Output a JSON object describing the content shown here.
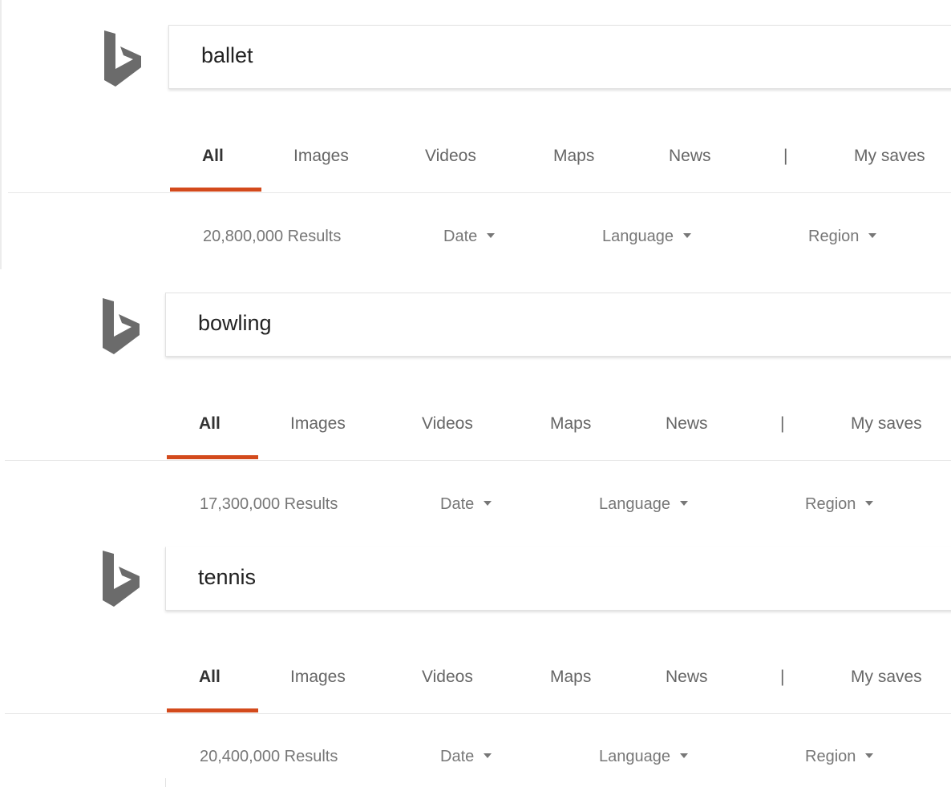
{
  "colors": {
    "accent": "#d34a1c",
    "logo": "#6b6b6b",
    "text": "#666666"
  },
  "logo_icon": "bing-b-icon",
  "nav": {
    "tabs": [
      {
        "label": "All",
        "active": true
      },
      {
        "label": "Images",
        "active": false
      },
      {
        "label": "Videos",
        "active": false
      },
      {
        "label": "Maps",
        "active": false
      },
      {
        "label": "News",
        "active": false
      }
    ],
    "separator": "|",
    "my_saves": "My saves"
  },
  "filters": {
    "date": "Date",
    "language": "Language",
    "region": "Region"
  },
  "searches": [
    {
      "query": "ballet",
      "results": "20,800,000 Results"
    },
    {
      "query": "bowling",
      "results": "17,300,000 Results"
    },
    {
      "query": "tennis",
      "results": "20,400,000 Results"
    }
  ]
}
